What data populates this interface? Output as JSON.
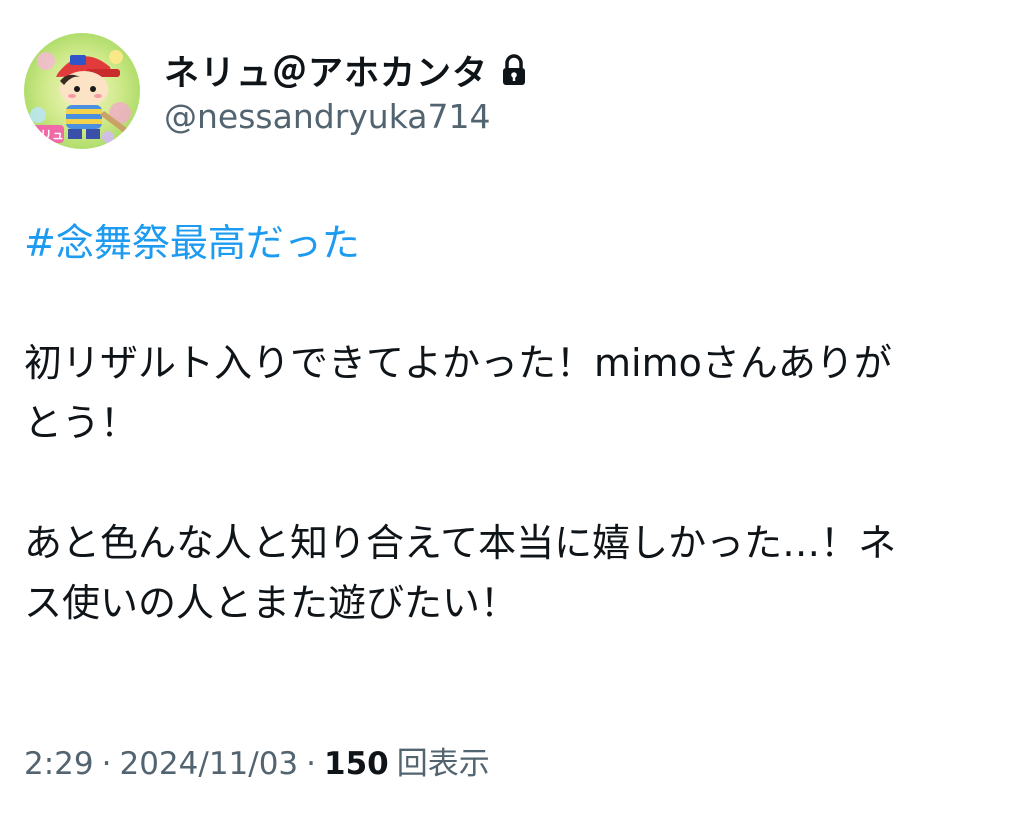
{
  "user": {
    "display_name": "ネリュ＠アホカンタ",
    "handle": "@nessandryuka714",
    "locked": true,
    "avatar_icon": "character-avatar-icon",
    "lock_icon": "lock-icon"
  },
  "tweet": {
    "hashtag": "#念舞祭最高だった",
    "paragraph1": {
      "line1": "初リザルト入りできてよかった！mimoさんありが",
      "line2": "とう！"
    },
    "paragraph2": {
      "line1": "あと色んな人と知り合えて本当に嬉しかった…！ネ",
      "line2": "ス使いの人とまた遊びたい！"
    }
  },
  "meta": {
    "time": "2:29",
    "separator": "·",
    "date": "2024/11/03",
    "view_count": "150",
    "view_label": "回表示"
  },
  "colors": {
    "hashtag": "#1d9bf0",
    "text": "#0f1419",
    "secondary": "#536471"
  }
}
